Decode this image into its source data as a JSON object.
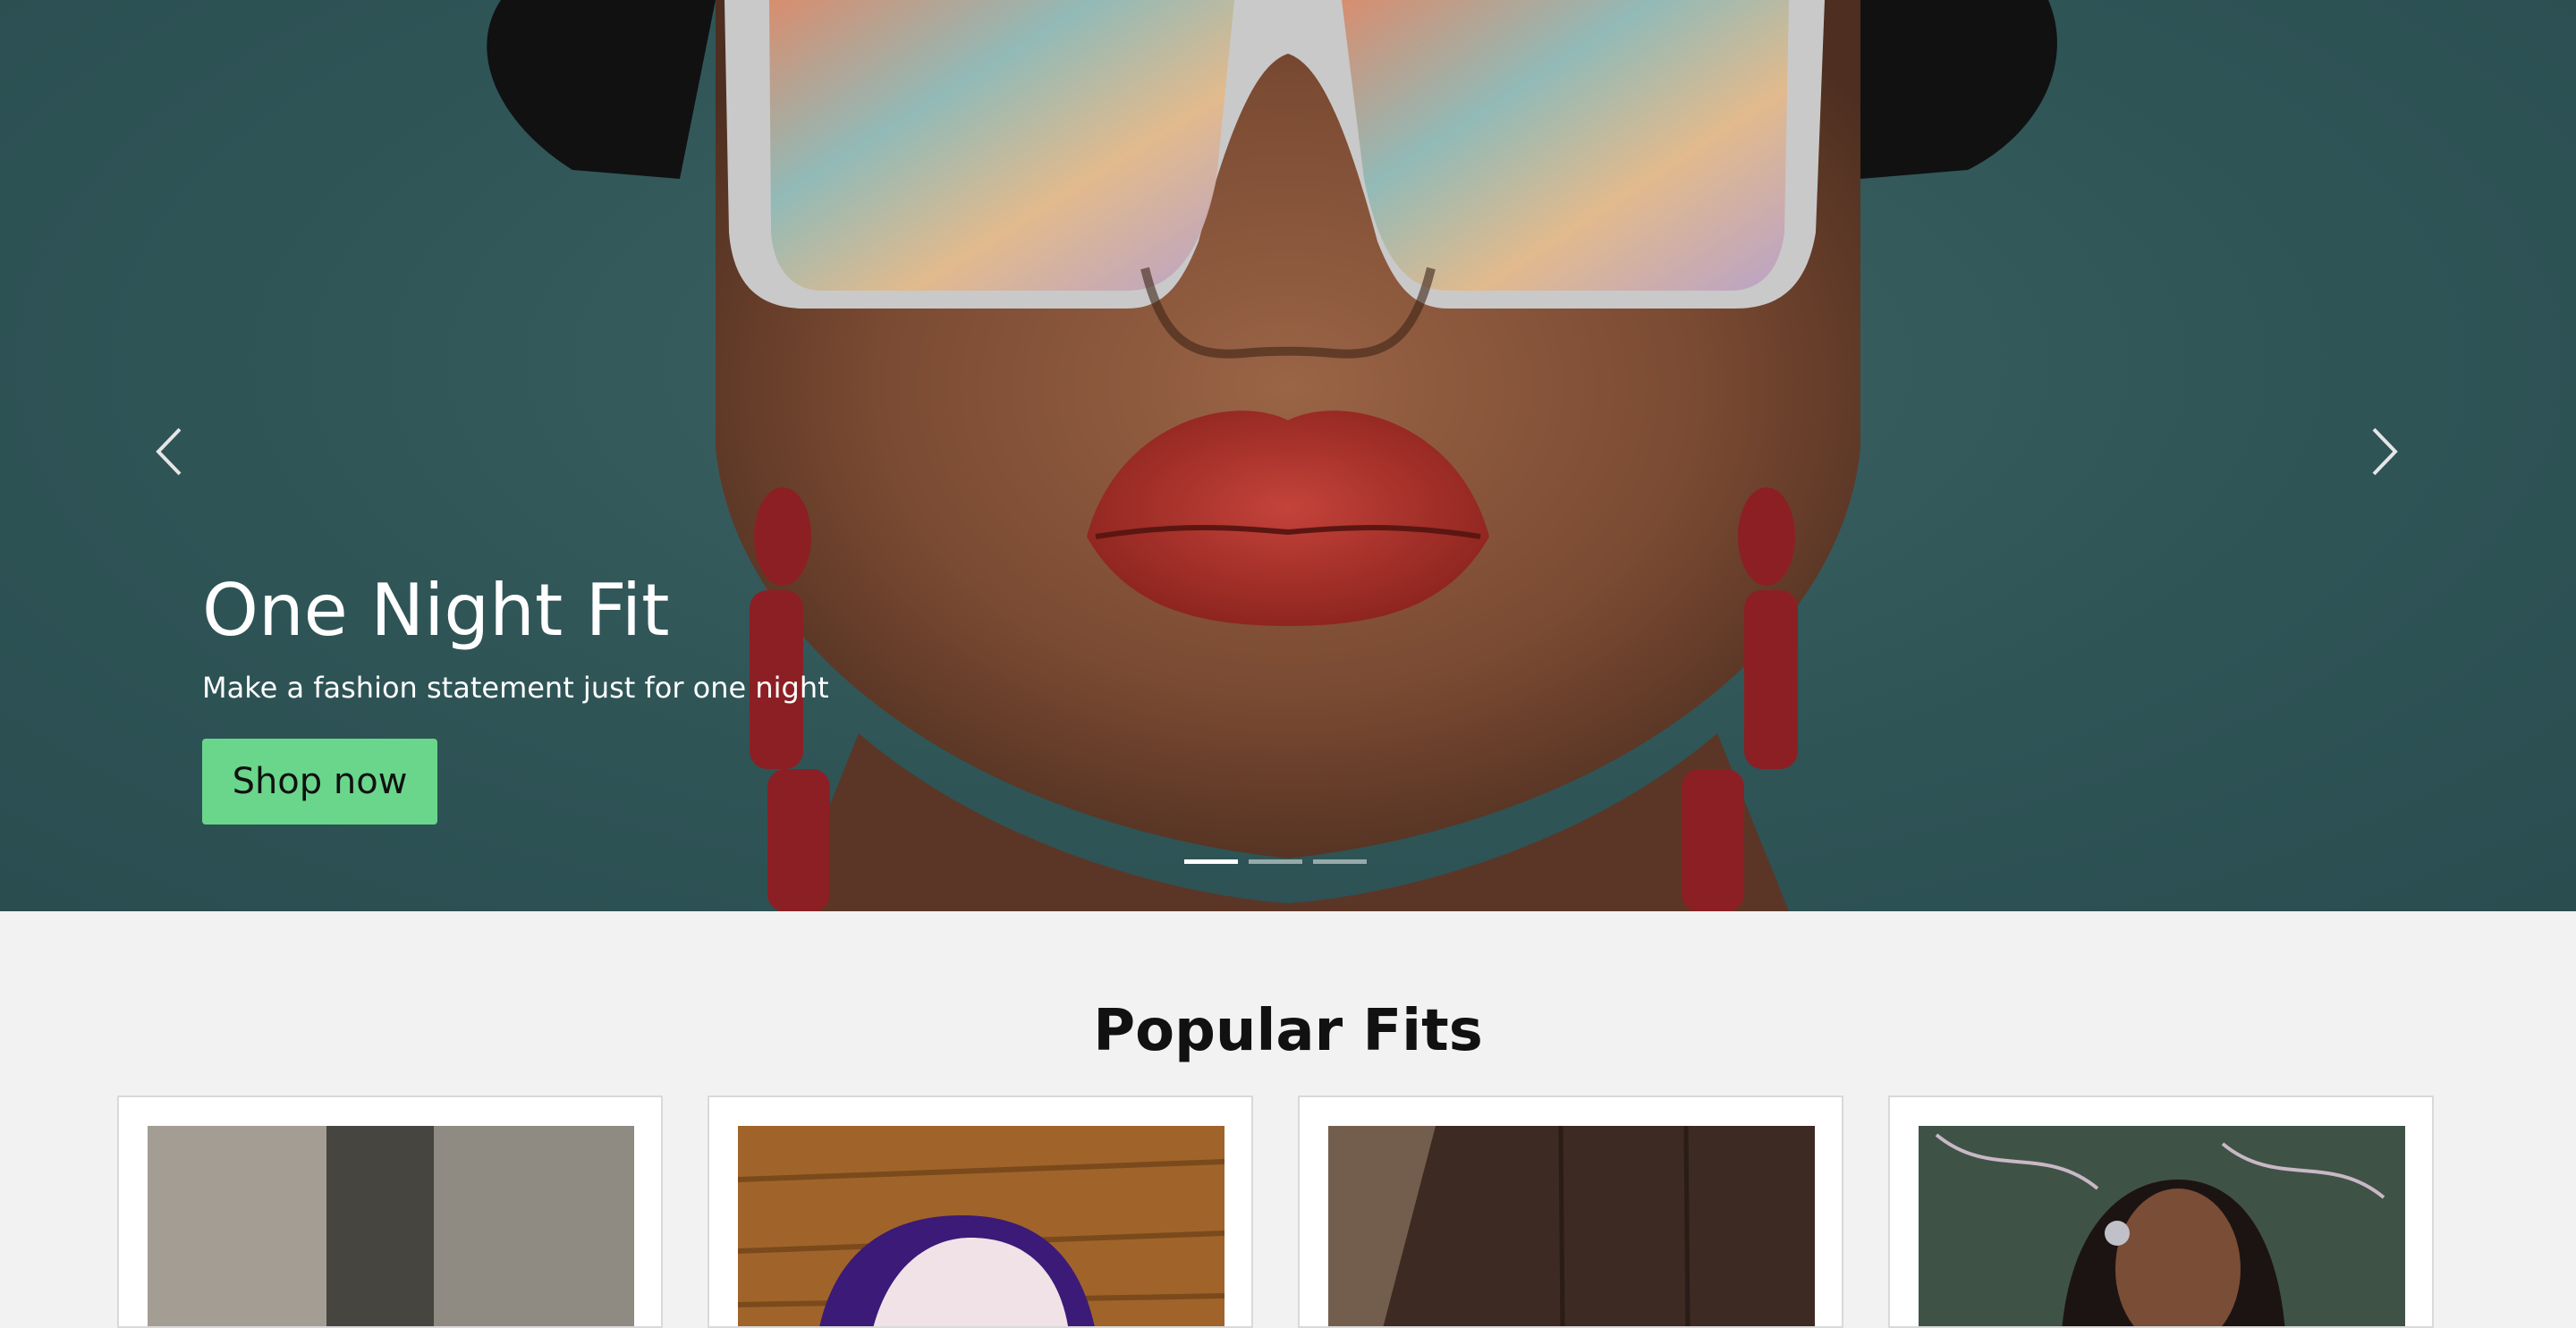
{
  "hero": {
    "slide_title": "One Night Fit",
    "slide_subtitle": "Make a fashion statement just for one night",
    "cta_label": "Shop now",
    "prev_icon": "chevron-left-icon",
    "next_icon": "chevron-right-icon",
    "indicator_count": 3,
    "active_indicator": 1
  },
  "popular": {
    "title": "Popular Fits",
    "cards": [
      {
        "image": "product-photo"
      },
      {
        "image": "product-photo"
      },
      {
        "image": "product-photo"
      },
      {
        "image": "product-photo"
      }
    ]
  },
  "colors": {
    "hero_background": "#2f5557",
    "cta_background": "#6ad68b",
    "page_background": "#f2f2f2"
  }
}
